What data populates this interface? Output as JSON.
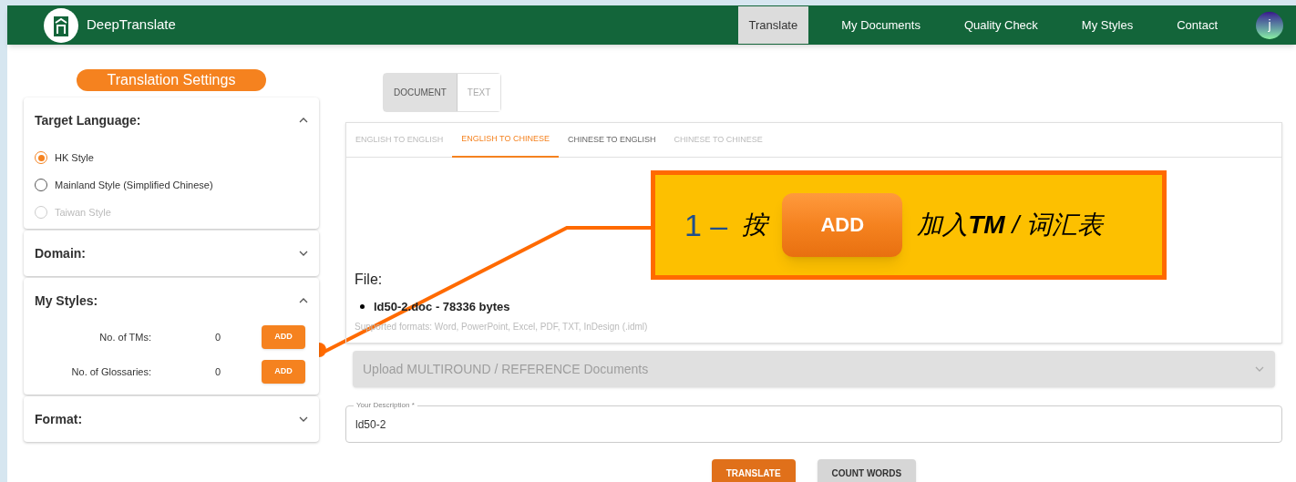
{
  "header": {
    "brand": "DeepTranslate",
    "nav": [
      {
        "label": "Translate",
        "selected": true
      },
      {
        "label": "My Documents",
        "selected": false
      },
      {
        "label": "Quality Check",
        "selected": false
      },
      {
        "label": "My Styles",
        "selected": false
      },
      {
        "label": "Contact",
        "selected": false
      }
    ],
    "avatar": "j"
  },
  "sidebar": {
    "title": "Translation Settings",
    "sections": [
      {
        "title": "Target Language:",
        "expanded": true,
        "options": [
          {
            "label": "HK Style",
            "selected": true,
            "disabled": false
          },
          {
            "label": "Mainland Style (Simplified Chinese)",
            "selected": false,
            "disabled": false
          },
          {
            "label": "Taiwan Style",
            "selected": false,
            "disabled": true
          }
        ]
      },
      {
        "title": "Domain:",
        "expanded": false
      },
      {
        "title": "My Styles:",
        "expanded": true,
        "rows": [
          {
            "label": "No. of TMs:",
            "count": "0",
            "button": "ADD"
          },
          {
            "label": "No. of Glossaries:",
            "count": "0",
            "button": "ADD"
          }
        ]
      },
      {
        "title": "Format:",
        "expanded": false
      }
    ]
  },
  "main": {
    "mode_toggle": [
      {
        "label": "DOCUMENT",
        "selected": true
      },
      {
        "label": "TEXT",
        "selected": false
      }
    ],
    "language_tabs": [
      {
        "label": "ENGLISH TO ENGLISH",
        "selected": false,
        "disabled": true
      },
      {
        "label": "ENGLISH TO CHINESE",
        "selected": true,
        "disabled": false
      },
      {
        "label": "CHINESE TO ENGLISH",
        "selected": false,
        "disabled": false
      },
      {
        "label": "CHINESE TO CHINESE",
        "selected": false,
        "disabled": true
      }
    ],
    "file_heading": "File:",
    "files": [
      "ld50-2.doc - 78336 bytes"
    ],
    "supported_formats": "Supported formats: Word, PowerPoint, Excel, PDF, TXT, InDesign (.idml)",
    "upload_panel": {
      "label": "Upload MULTIROUND / REFERENCE Documents",
      "expanded": false
    },
    "description": {
      "label": "Your Description *",
      "value": "ld50-2"
    },
    "buttons": [
      {
        "label": "TRANSLATE",
        "kind": "primary"
      },
      {
        "label": "COUNT WORDS",
        "kind": "secondary"
      }
    ]
  },
  "callout": {
    "step": "1 –",
    "before": "按",
    "button": "ADD",
    "after": "加入**TM** / 词汇表"
  }
}
